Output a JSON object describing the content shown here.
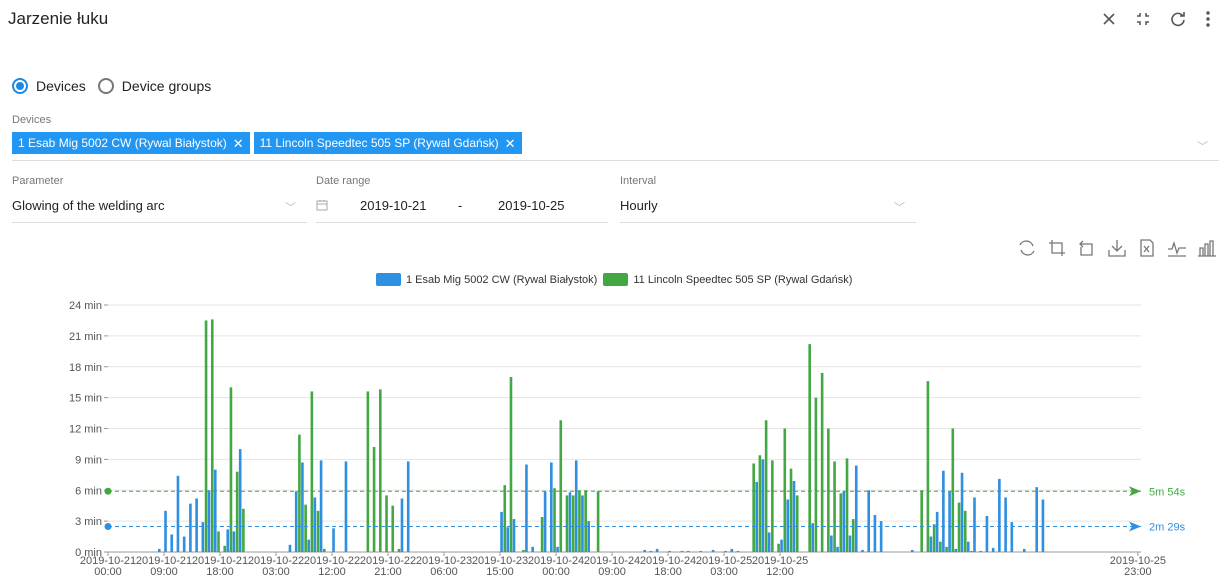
{
  "window": {
    "title": "Jarzenie łuku"
  },
  "top_icons": [
    "close-icon",
    "collapse-icon",
    "refresh-icon",
    "more-vert-icon"
  ],
  "mode": {
    "options": [
      {
        "label": "Devices",
        "selected": true
      },
      {
        "label": "Device groups",
        "selected": false
      }
    ]
  },
  "devices": {
    "label": "Devices",
    "chips": [
      {
        "label": "1 Esab Mig 5002 CW (Rywal Białystok)"
      },
      {
        "label": "11 Lincoln Speedtec 505 SP (Rywal Gdańsk)"
      }
    ]
  },
  "parameter": {
    "label": "Parameter",
    "value": "Glowing of the welding arc"
  },
  "date_range": {
    "label": "Date range",
    "from": "2019-10-21",
    "separator": "-",
    "to": "2019-10-25"
  },
  "interval": {
    "label": "Interval",
    "value": "Hourly"
  },
  "toolbox": [
    "restore-icon",
    "zoom-icon",
    "zoom-back-icon",
    "download-icon",
    "excel-icon",
    "line-chart-icon",
    "bar-chart-icon"
  ],
  "colors": {
    "series1": "#2f8fe0",
    "series2": "#43a843"
  },
  "chart_data": {
    "type": "bar",
    "yticks": [
      "0 min",
      "3 min",
      "6 min",
      "9 min",
      "12 min",
      "15 min",
      "18 min",
      "21 min",
      "24 min"
    ],
    "ylim": [
      0,
      24
    ],
    "unit": "min",
    "xticks": [
      {
        "date": "2019-10-21",
        "time": "00:00"
      },
      {
        "date": "2019-10-21",
        "time": "09:00"
      },
      {
        "date": "2019-10-21",
        "time": "18:00"
      },
      {
        "date": "2019-10-22",
        "time": "03:00"
      },
      {
        "date": "2019-10-22",
        "time": "12:00"
      },
      {
        "date": "2019-10-22",
        "time": "21:00"
      },
      {
        "date": "2019-10-23",
        "time": "06:00"
      },
      {
        "date": "2019-10-23",
        "time": "15:00"
      },
      {
        "date": "2019-10-24",
        "time": "00:00"
      },
      {
        "date": "2019-10-24",
        "time": "09:00"
      },
      {
        "date": "2019-10-24",
        "time": "18:00"
      },
      {
        "date": "2019-10-25",
        "time": "03:00"
      },
      {
        "date": "2019-10-25",
        "time": "12:00"
      },
      {
        "date": "2019-10-25",
        "time": "23:00"
      }
    ],
    "series": [
      {
        "name": "1 Esab Mig 5002 CW (Rywal Białystok)",
        "average_label": "2m 29s",
        "average": 2.48,
        "points": [
          [
            8,
            0.3
          ],
          [
            9,
            4.0
          ],
          [
            10,
            1.7
          ],
          [
            11,
            7.4
          ],
          [
            12,
            1.5
          ],
          [
            13,
            4.7
          ],
          [
            14,
            5.2
          ],
          [
            15,
            2.9
          ],
          [
            16,
            6.0
          ],
          [
            17,
            8.0
          ],
          [
            19,
            2.2
          ],
          [
            20,
            2.0
          ],
          [
            21,
            10.0
          ],
          [
            29,
            0.7
          ],
          [
            30,
            5.9
          ],
          [
            31,
            8.7
          ],
          [
            32,
            1.2
          ],
          [
            33,
            5.3
          ],
          [
            34,
            8.9
          ],
          [
            36,
            2.3
          ],
          [
            38,
            8.8
          ],
          [
            47,
            5.2
          ],
          [
            48,
            8.8
          ],
          [
            63,
            3.9
          ],
          [
            64,
            2.4
          ],
          [
            65,
            3.2
          ],
          [
            67,
            8.5
          ],
          [
            68,
            0.5
          ],
          [
            70,
            5.9
          ],
          [
            71,
            8.7
          ],
          [
            72,
            0.5
          ],
          [
            74,
            5.8
          ],
          [
            75,
            8.9
          ],
          [
            76,
            5.5
          ],
          [
            77,
            3.0
          ],
          [
            86,
            0.2
          ],
          [
            87,
            0.1
          ],
          [
            88,
            0.3
          ],
          [
            90,
            0.1
          ],
          [
            92,
            0.1
          ],
          [
            93,
            0.1
          ],
          [
            95,
            0.1
          ],
          [
            97,
            0.2
          ],
          [
            99,
            0.1
          ],
          [
            100,
            0.3
          ],
          [
            101,
            0.1
          ],
          [
            104,
            6.8
          ],
          [
            105,
            9.0
          ],
          [
            106,
            1.9
          ],
          [
            108,
            1.2
          ],
          [
            109,
            5.1
          ],
          [
            110,
            6.9
          ],
          [
            113,
            2.8
          ],
          [
            116,
            1.6
          ],
          [
            117,
            0.5
          ],
          [
            118,
            5.9
          ],
          [
            119,
            1.6
          ],
          [
            120,
            8.4
          ],
          [
            121,
            0.2
          ],
          [
            122,
            6.0
          ],
          [
            123,
            3.6
          ],
          [
            124,
            3.0
          ],
          [
            129,
            0.2
          ],
          [
            132,
            1.5
          ],
          [
            133,
            3.9
          ],
          [
            134,
            7.9
          ],
          [
            135,
            5.9
          ],
          [
            136,
            0.3
          ],
          [
            137,
            7.7
          ],
          [
            138,
            1.0
          ],
          [
            139,
            5.3
          ],
          [
            140,
            0.1
          ],
          [
            141,
            3.5
          ],
          [
            142,
            0.4
          ],
          [
            143,
            7.1
          ],
          [
            144,
            5.3
          ],
          [
            145,
            2.9
          ],
          [
            147,
            0.3
          ],
          [
            149,
            6.3
          ],
          [
            150,
            5.1
          ]
        ]
      },
      {
        "name": "11 Lincoln Speedtec 505 SP (Rywal Gdańsk)",
        "average_label": "5m 54s",
        "average": 5.9,
        "points": [
          [
            15,
            22.5
          ],
          [
            16,
            22.6
          ],
          [
            17,
            2.0
          ],
          [
            18,
            0.6
          ],
          [
            19,
            16.0
          ],
          [
            20,
            7.8
          ],
          [
            21,
            4.2
          ],
          [
            30,
            11.4
          ],
          [
            31,
            4.6
          ],
          [
            32,
            15.6
          ],
          [
            33,
            4.0
          ],
          [
            34,
            0.3
          ],
          [
            41,
            15.6
          ],
          [
            42,
            10.2
          ],
          [
            43,
            15.8
          ],
          [
            44,
            5.5
          ],
          [
            45,
            4.5
          ],
          [
            46,
            0.3
          ],
          [
            63,
            6.5
          ],
          [
            64,
            17.0
          ],
          [
            66,
            0.2
          ],
          [
            69,
            3.4
          ],
          [
            71,
            6.2
          ],
          [
            72,
            12.8
          ],
          [
            73,
            5.5
          ],
          [
            74,
            5.5
          ],
          [
            75,
            6.0
          ],
          [
            76,
            6.0
          ],
          [
            78,
            5.9
          ],
          [
            103,
            8.6
          ],
          [
            104,
            9.4
          ],
          [
            105,
            12.8
          ],
          [
            106,
            8.9
          ],
          [
            107,
            0.8
          ],
          [
            108,
            12.0
          ],
          [
            109,
            8.1
          ],
          [
            110,
            5.5
          ],
          [
            112,
            20.2
          ],
          [
            113,
            15.0
          ],
          [
            114,
            17.4
          ],
          [
            115,
            12.0
          ],
          [
            116,
            8.8
          ],
          [
            117,
            5.7
          ],
          [
            118,
            9.1
          ],
          [
            119,
            3.2
          ],
          [
            130,
            6.0
          ],
          [
            131,
            16.6
          ],
          [
            132,
            2.7
          ],
          [
            133,
            1.0
          ],
          [
            134,
            0.5
          ],
          [
            135,
            12.0
          ],
          [
            136,
            4.8
          ],
          [
            137,
            4.0
          ],
          [
            138,
            0.1
          ]
        ]
      }
    ]
  }
}
